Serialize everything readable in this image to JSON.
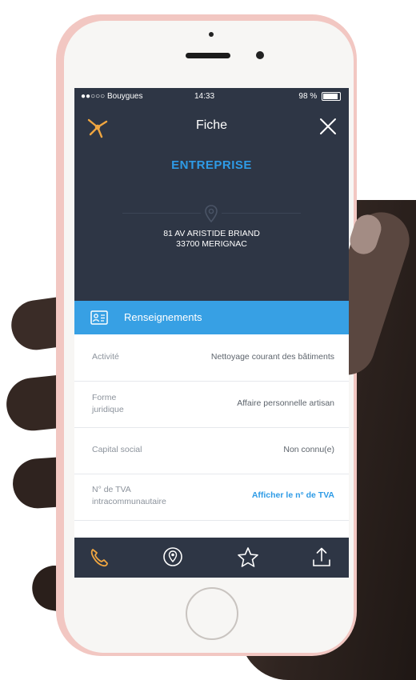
{
  "status_bar": {
    "carrier": "●●○○○ Bouygues",
    "time": "14:33",
    "battery": "98 %"
  },
  "nav": {
    "title": "Fiche",
    "logo_icon": "pagesjaunes-logo-icon",
    "close_icon": "close-icon"
  },
  "company": {
    "name": "ENTREPRISE",
    "address_line1": "81 AV ARISTIDE BRIAND",
    "address_line2": "33700 MERIGNAC"
  },
  "section": {
    "label": "Renseignements",
    "icon": "id-card-icon"
  },
  "info_rows": [
    {
      "label": "Activité",
      "value": "Nettoyage courant des bâtiments"
    },
    {
      "label_line1": "Forme",
      "label_line2": "juridique",
      "value": "Affaire personnelle artisan"
    },
    {
      "label": "Capital social",
      "value": "Non connu(e)"
    },
    {
      "label_line1": "N° de TVA",
      "label_line2": "intracommunautaire",
      "value": "Afficher le n° de TVA"
    }
  ],
  "tab_bar": {
    "items": [
      "phone-icon",
      "location-pin-icon",
      "star-icon",
      "share-icon"
    ]
  },
  "colors": {
    "screen_bg": "#2e3645",
    "accent_blue": "#37a0e4",
    "link_blue": "#2e9be6",
    "gold": "#f0a640",
    "phone_body": "#f2c7c2"
  }
}
